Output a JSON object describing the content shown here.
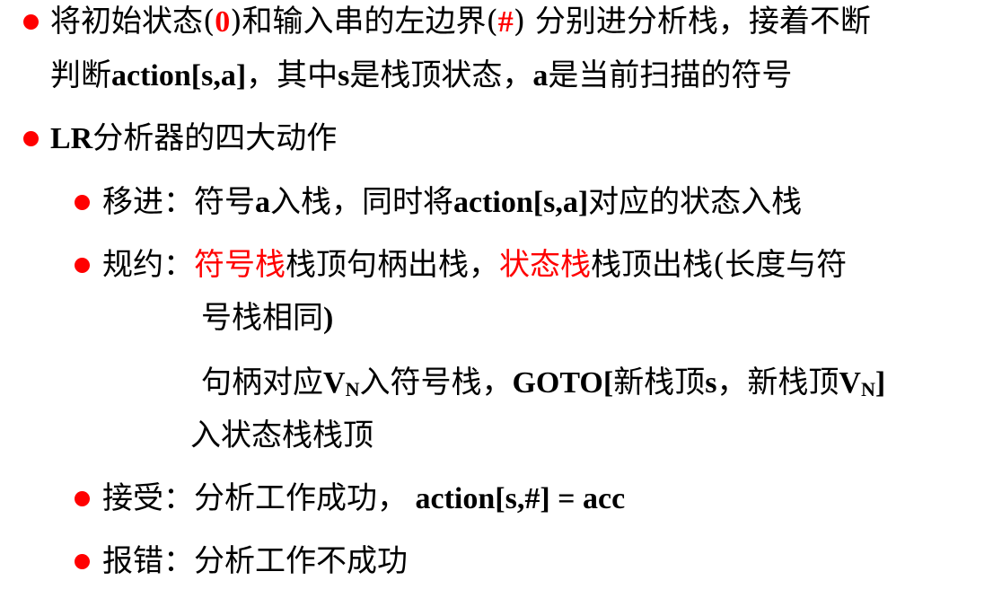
{
  "colors": {
    "bullet": "#ff0000",
    "highlight": "#ff0000",
    "text": "#000000"
  },
  "item1": {
    "p1": "将初始状态(",
    "zero": "0",
    "p2": ")和输入串的左边界(",
    "hash": "#",
    "p3": ") 分别进分析栈，接着不断",
    "l2a": "判断",
    "l2b": "action[s,a]",
    "l2c": "，其中",
    "l2d": "s",
    "l2e": "是栈顶状态，",
    "l2f": "a",
    "l2g": "是当前扫描的符号"
  },
  "item2": {
    "lr": "LR",
    "rest": "分析器的四大动作"
  },
  "shift": {
    "p1": "移进：符号",
    "a": "a",
    "p2": "入栈，同时将",
    "action": "action[s,a]",
    "p3": "对应的状态入栈"
  },
  "reduce": {
    "p1": "规约：",
    "red1": "符号栈",
    "p2": "栈顶句柄出栈，",
    "red2": "状态栈",
    "p3": "栈顶出栈(长度与符",
    "line2a": "号栈相同",
    "line2b": ")",
    "line3a": "句柄对应",
    "vn1": "V",
    "vn1sub": "N",
    "line3b": "入符号栈，",
    "goto": "GOTO[",
    "line3c": "新栈顶",
    "s": "s",
    "line3d": "，新栈顶",
    "vn2": "V",
    "vn2sub": "N",
    "close": "]",
    "line4": "入状态栈栈顶"
  },
  "accept": {
    "p1": "接受：分析工作成功，",
    "code": " action[s,#] = acc"
  },
  "error": {
    "p1": "报错：分析工作不成功"
  }
}
